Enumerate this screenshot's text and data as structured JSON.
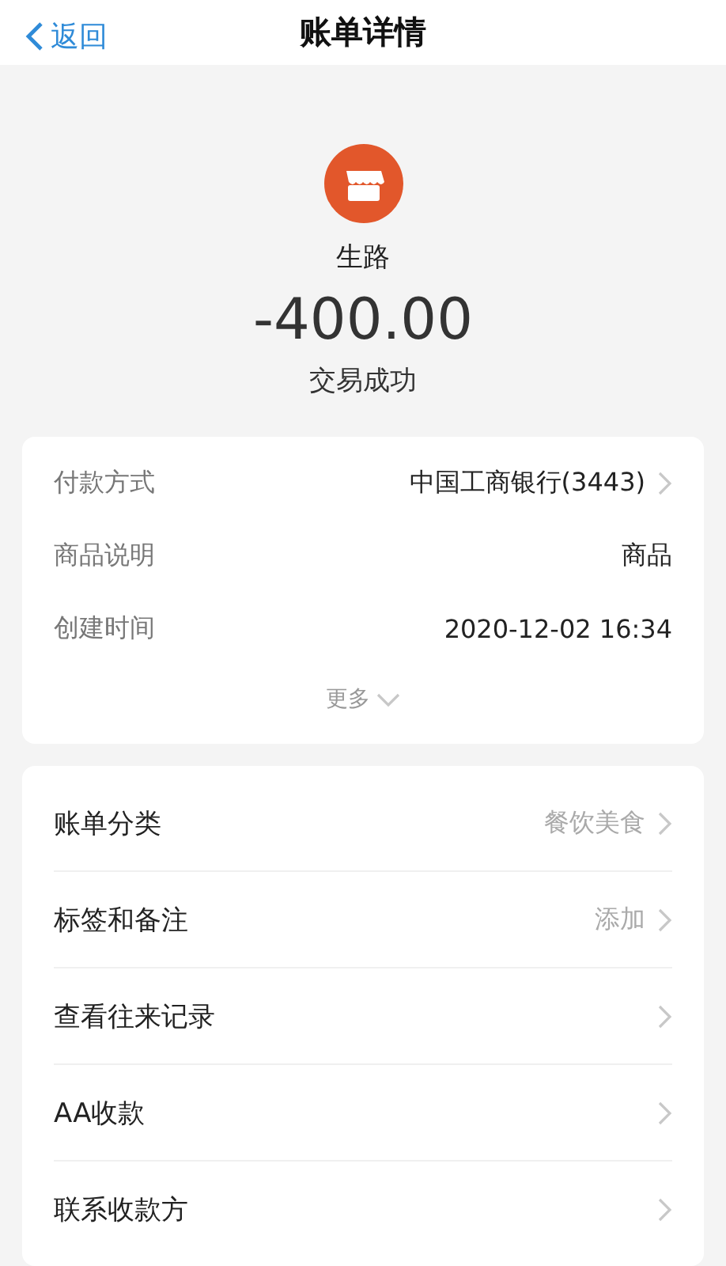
{
  "nav": {
    "back": "返回",
    "title": "账单详情"
  },
  "merchant": {
    "name": "生路",
    "amount": "-400.00",
    "status": "交易成功"
  },
  "details": {
    "rows": [
      {
        "label": "付款方式",
        "value": "中国工商银行(3443)",
        "chevron": true
      },
      {
        "label": "商品说明",
        "value": "商品",
        "chevron": false
      },
      {
        "label": "创建时间",
        "value": "2020-12-02 16:34",
        "chevron": false
      }
    ],
    "more": "更多"
  },
  "actions": [
    {
      "label": "账单分类",
      "value": "餐饮美食"
    },
    {
      "label": "标签和备注",
      "value": "添加"
    },
    {
      "label": "查看往来记录"
    },
    {
      "label": "AA收款"
    },
    {
      "label": "联系收款方"
    }
  ]
}
